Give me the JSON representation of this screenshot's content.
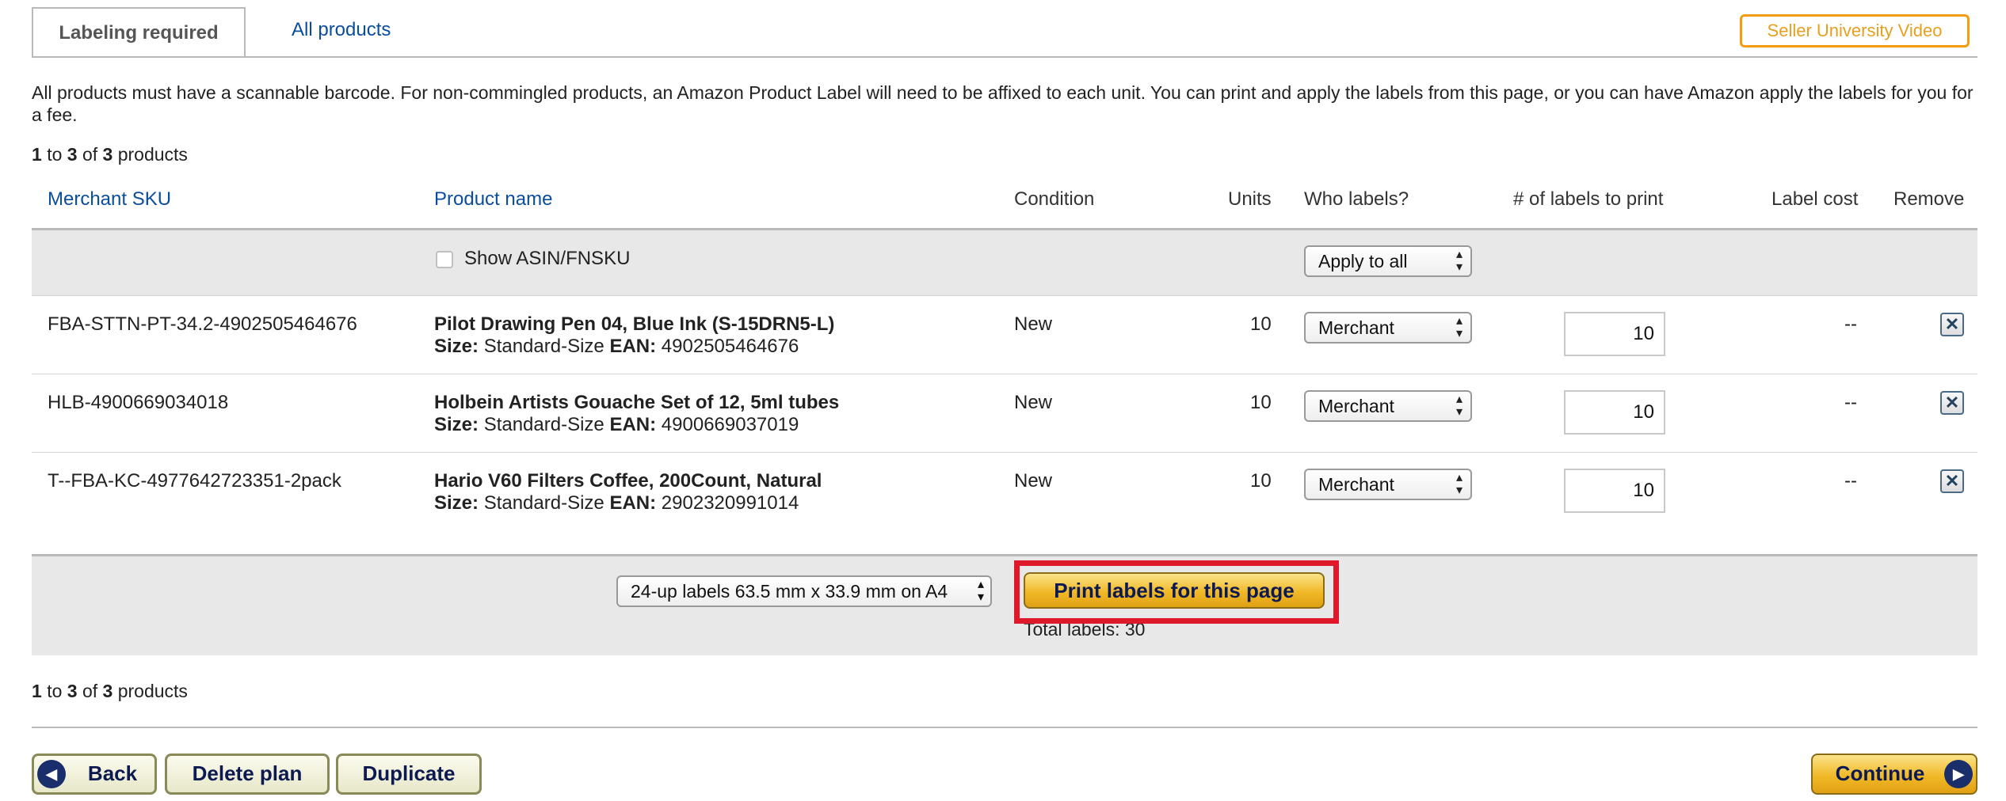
{
  "tabs": {
    "active": "Labeling required",
    "other": "All products"
  },
  "seller_video": "Seller University Video",
  "intro": "All products must have a scannable barcode. For non-commingled products, an Amazon Product Label will need to be affixed to each unit. You can print and apply the labels from this page, or you can have Amazon apply the labels for you for a fee.",
  "pagination": {
    "from": "1",
    "to_word": "to",
    "to": "3",
    "of_word": "of",
    "total": "3",
    "suffix": "products"
  },
  "table": {
    "headers": {
      "sku": "Merchant SKU",
      "product": "Product name",
      "condition": "Condition",
      "units": "Units",
      "who": "Who labels?",
      "labels": "# of labels to print",
      "cost": "Label cost",
      "remove": "Remove"
    },
    "show_asin": "Show ASIN/FNSKU",
    "apply_all": "Apply to all",
    "rows": [
      {
        "sku": "FBA-STTN-PT-34.2-4902505464676",
        "name": "Pilot Drawing Pen 04, Blue Ink (S-15DRN5-L)",
        "size_label": "Size:",
        "size": "Standard-Size",
        "ean_label": "EAN:",
        "ean": "4902505464676",
        "condition": "New",
        "units": "10",
        "who": "Merchant",
        "labels": "10",
        "cost": "--"
      },
      {
        "sku": "HLB-4900669034018",
        "name": "Holbein Artists Gouache Set of 12, 5ml tubes",
        "size_label": "Size:",
        "size": "Standard-Size",
        "ean_label": "EAN:",
        "ean": "4900669037019",
        "condition": "New",
        "units": "10",
        "who": "Merchant",
        "labels": "10",
        "cost": "--"
      },
      {
        "sku": "T--FBA-KC-4977642723351-2pack",
        "name": "Hario V60 Filters Coffee, 200Count, Natural",
        "size_label": "Size:",
        "size": "Standard-Size",
        "ean_label": "EAN:",
        "ean": "2902320991014",
        "condition": "New",
        "units": "10",
        "who": "Merchant",
        "labels": "10",
        "cost": "--"
      }
    ]
  },
  "print": {
    "format": "24-up labels 63.5 mm x 33.9 mm on A4",
    "button": "Print labels for this page",
    "total": "Total labels: 30"
  },
  "footer": {
    "back": "Back",
    "delete": "Delete plan",
    "duplicate": "Duplicate",
    "continue": "Continue"
  },
  "colors": {
    "link": "#0a4d9c",
    "highlight": "#e0182b",
    "accent": "#f39c12"
  }
}
